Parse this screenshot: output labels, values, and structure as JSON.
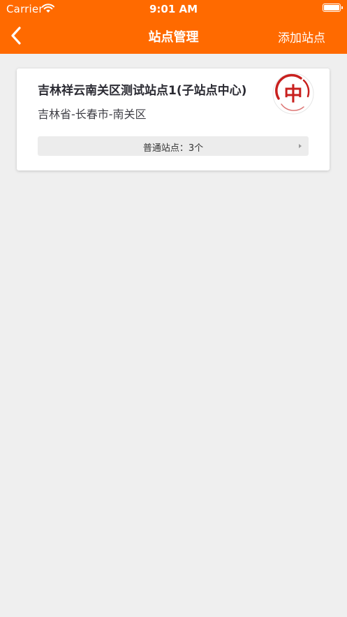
{
  "status_bar": {
    "carrier": "Carrier",
    "time": "9:01 AM"
  },
  "navbar": {
    "title": "站点管理",
    "add_label": "添加站点",
    "accent_color": "#ff6a00"
  },
  "sites": [
    {
      "name": "吉林祥云南关区测试站点1(子站点中心)",
      "region": "吉林省-长春市-南关区",
      "logo_char": "中",
      "subsites_summary": "普通站点：3个"
    }
  ],
  "colors": {
    "background": "#efefef",
    "logo_red": "#c8201e"
  },
  "icons": {
    "back": "chevron-left-icon",
    "wifi": "wifi-icon",
    "battery": "battery-icon",
    "subsites_arrow": "triangle-right-icon"
  }
}
